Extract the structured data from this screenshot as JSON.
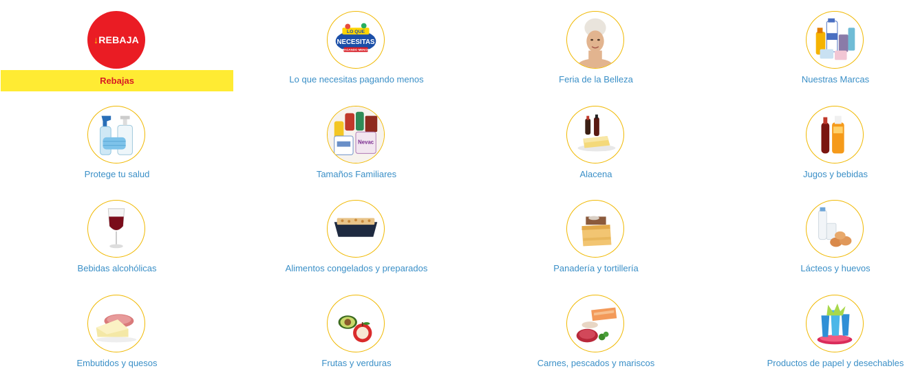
{
  "colors": {
    "accent_yellow": "#ffeb33",
    "accent_red": "#ea1c24",
    "link_blue": "#3a8fc7",
    "circle_border": "#f0b800"
  },
  "categories": [
    {
      "label": "Rebajas",
      "icon": "rebaja-badge-icon",
      "badge_text": "REBAJA",
      "active": true
    },
    {
      "label": "Lo que necesitas pagando menos",
      "icon": "lo-que-necesitas-logo-icon",
      "logo_top": "LO QUE",
      "logo_main": "NECESITAS",
      "logo_sub": "PAGANDO MENOS"
    },
    {
      "label": "Feria de la Belleza",
      "icon": "woman-towel-icon"
    },
    {
      "label": "Nuestras Marcas",
      "icon": "store-brand-products-icon"
    },
    {
      "label": "Protege tu salud",
      "icon": "sanitizer-mask-icon"
    },
    {
      "label": "Tamaños Familiares",
      "icon": "family-size-products-icon",
      "logo_main": "Nevac"
    },
    {
      "label": "Alacena",
      "icon": "sauces-butter-icon"
    },
    {
      "label": "Jugos y bebidas",
      "icon": "juice-bottles-icon"
    },
    {
      "label": "Bebidas alcohólicas",
      "icon": "wine-glass-icon"
    },
    {
      "label": "Alimentos congelados y preparados",
      "icon": "frozen-tray-icon"
    },
    {
      "label": "Panadería y tortillería",
      "icon": "cake-slice-icon"
    },
    {
      "label": "Lácteos y huevos",
      "icon": "milk-eggs-icon"
    },
    {
      "label": "Embutidos y quesos",
      "icon": "cheese-ham-icon"
    },
    {
      "label": "Frutas y verduras",
      "icon": "avocado-apple-icon"
    },
    {
      "label": "Carnes, pescados y mariscos",
      "icon": "meat-fish-icon"
    },
    {
      "label": "Productos de papel y desechables",
      "icon": "disposable-cups-icon"
    }
  ]
}
